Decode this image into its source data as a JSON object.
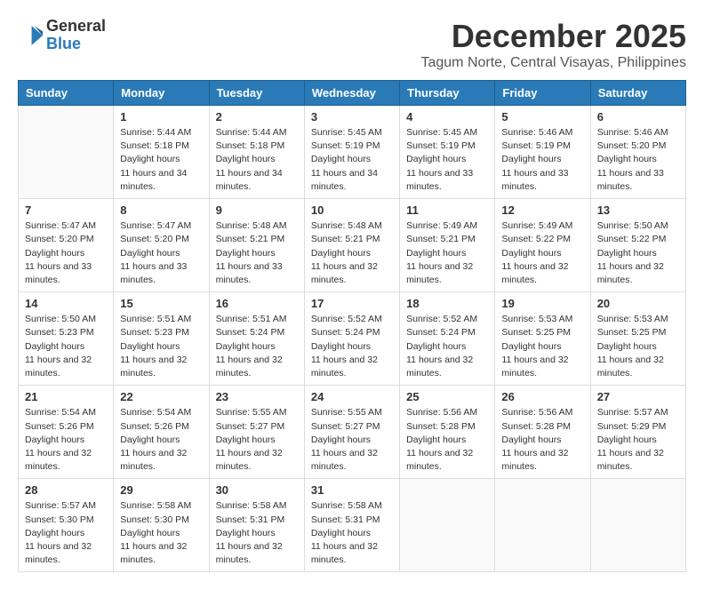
{
  "header": {
    "logo_general": "General",
    "logo_blue": "Blue",
    "month": "December 2025",
    "location": "Tagum Norte, Central Visayas, Philippines"
  },
  "columns": [
    "Sunday",
    "Monday",
    "Tuesday",
    "Wednesday",
    "Thursday",
    "Friday",
    "Saturday"
  ],
  "weeks": [
    [
      {
        "day": "",
        "sunrise": "",
        "sunset": "",
        "daylight": ""
      },
      {
        "day": "1",
        "sunrise": "5:44 AM",
        "sunset": "5:18 PM",
        "daylight": "11 hours and 34 minutes."
      },
      {
        "day": "2",
        "sunrise": "5:44 AM",
        "sunset": "5:18 PM",
        "daylight": "11 hours and 34 minutes."
      },
      {
        "day": "3",
        "sunrise": "5:45 AM",
        "sunset": "5:19 PM",
        "daylight": "11 hours and 34 minutes."
      },
      {
        "day": "4",
        "sunrise": "5:45 AM",
        "sunset": "5:19 PM",
        "daylight": "11 hours and 33 minutes."
      },
      {
        "day": "5",
        "sunrise": "5:46 AM",
        "sunset": "5:19 PM",
        "daylight": "11 hours and 33 minutes."
      },
      {
        "day": "6",
        "sunrise": "5:46 AM",
        "sunset": "5:20 PM",
        "daylight": "11 hours and 33 minutes."
      }
    ],
    [
      {
        "day": "7",
        "sunrise": "5:47 AM",
        "sunset": "5:20 PM",
        "daylight": "11 hours and 33 minutes."
      },
      {
        "day": "8",
        "sunrise": "5:47 AM",
        "sunset": "5:20 PM",
        "daylight": "11 hours and 33 minutes."
      },
      {
        "day": "9",
        "sunrise": "5:48 AM",
        "sunset": "5:21 PM",
        "daylight": "11 hours and 33 minutes."
      },
      {
        "day": "10",
        "sunrise": "5:48 AM",
        "sunset": "5:21 PM",
        "daylight": "11 hours and 32 minutes."
      },
      {
        "day": "11",
        "sunrise": "5:49 AM",
        "sunset": "5:21 PM",
        "daylight": "11 hours and 32 minutes."
      },
      {
        "day": "12",
        "sunrise": "5:49 AM",
        "sunset": "5:22 PM",
        "daylight": "11 hours and 32 minutes."
      },
      {
        "day": "13",
        "sunrise": "5:50 AM",
        "sunset": "5:22 PM",
        "daylight": "11 hours and 32 minutes."
      }
    ],
    [
      {
        "day": "14",
        "sunrise": "5:50 AM",
        "sunset": "5:23 PM",
        "daylight": "11 hours and 32 minutes."
      },
      {
        "day": "15",
        "sunrise": "5:51 AM",
        "sunset": "5:23 PM",
        "daylight": "11 hours and 32 minutes."
      },
      {
        "day": "16",
        "sunrise": "5:51 AM",
        "sunset": "5:24 PM",
        "daylight": "11 hours and 32 minutes."
      },
      {
        "day": "17",
        "sunrise": "5:52 AM",
        "sunset": "5:24 PM",
        "daylight": "11 hours and 32 minutes."
      },
      {
        "day": "18",
        "sunrise": "5:52 AM",
        "sunset": "5:24 PM",
        "daylight": "11 hours and 32 minutes."
      },
      {
        "day": "19",
        "sunrise": "5:53 AM",
        "sunset": "5:25 PM",
        "daylight": "11 hours and 32 minutes."
      },
      {
        "day": "20",
        "sunrise": "5:53 AM",
        "sunset": "5:25 PM",
        "daylight": "11 hours and 32 minutes."
      }
    ],
    [
      {
        "day": "21",
        "sunrise": "5:54 AM",
        "sunset": "5:26 PM",
        "daylight": "11 hours and 32 minutes."
      },
      {
        "day": "22",
        "sunrise": "5:54 AM",
        "sunset": "5:26 PM",
        "daylight": "11 hours and 32 minutes."
      },
      {
        "day": "23",
        "sunrise": "5:55 AM",
        "sunset": "5:27 PM",
        "daylight": "11 hours and 32 minutes."
      },
      {
        "day": "24",
        "sunrise": "5:55 AM",
        "sunset": "5:27 PM",
        "daylight": "11 hours and 32 minutes."
      },
      {
        "day": "25",
        "sunrise": "5:56 AM",
        "sunset": "5:28 PM",
        "daylight": "11 hours and 32 minutes."
      },
      {
        "day": "26",
        "sunrise": "5:56 AM",
        "sunset": "5:28 PM",
        "daylight": "11 hours and 32 minutes."
      },
      {
        "day": "27",
        "sunrise": "5:57 AM",
        "sunset": "5:29 PM",
        "daylight": "11 hours and 32 minutes."
      }
    ],
    [
      {
        "day": "28",
        "sunrise": "5:57 AM",
        "sunset": "5:30 PM",
        "daylight": "11 hours and 32 minutes."
      },
      {
        "day": "29",
        "sunrise": "5:58 AM",
        "sunset": "5:30 PM",
        "daylight": "11 hours and 32 minutes."
      },
      {
        "day": "30",
        "sunrise": "5:58 AM",
        "sunset": "5:31 PM",
        "daylight": "11 hours and 32 minutes."
      },
      {
        "day": "31",
        "sunrise": "5:58 AM",
        "sunset": "5:31 PM",
        "daylight": "11 hours and 32 minutes."
      },
      {
        "day": "",
        "sunrise": "",
        "sunset": "",
        "daylight": ""
      },
      {
        "day": "",
        "sunrise": "",
        "sunset": "",
        "daylight": ""
      },
      {
        "day": "",
        "sunrise": "",
        "sunset": "",
        "daylight": ""
      }
    ]
  ]
}
